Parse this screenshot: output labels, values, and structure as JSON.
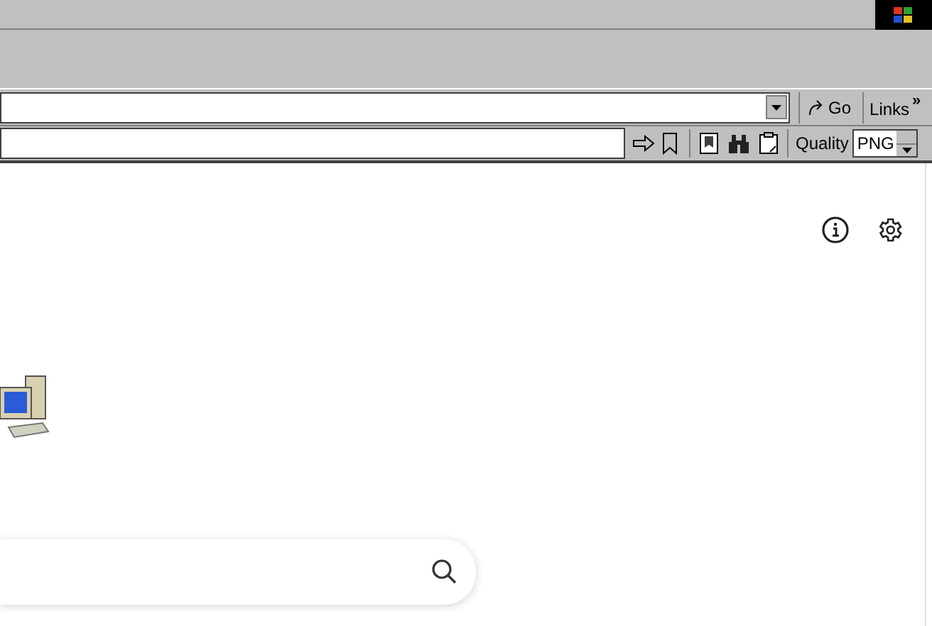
{
  "address_bar": {
    "go_button": "Go",
    "links_button": "Links",
    "links_chevron": "»"
  },
  "capture_toolbar": {
    "quality_label": "Quality",
    "format_value": "PNG"
  }
}
